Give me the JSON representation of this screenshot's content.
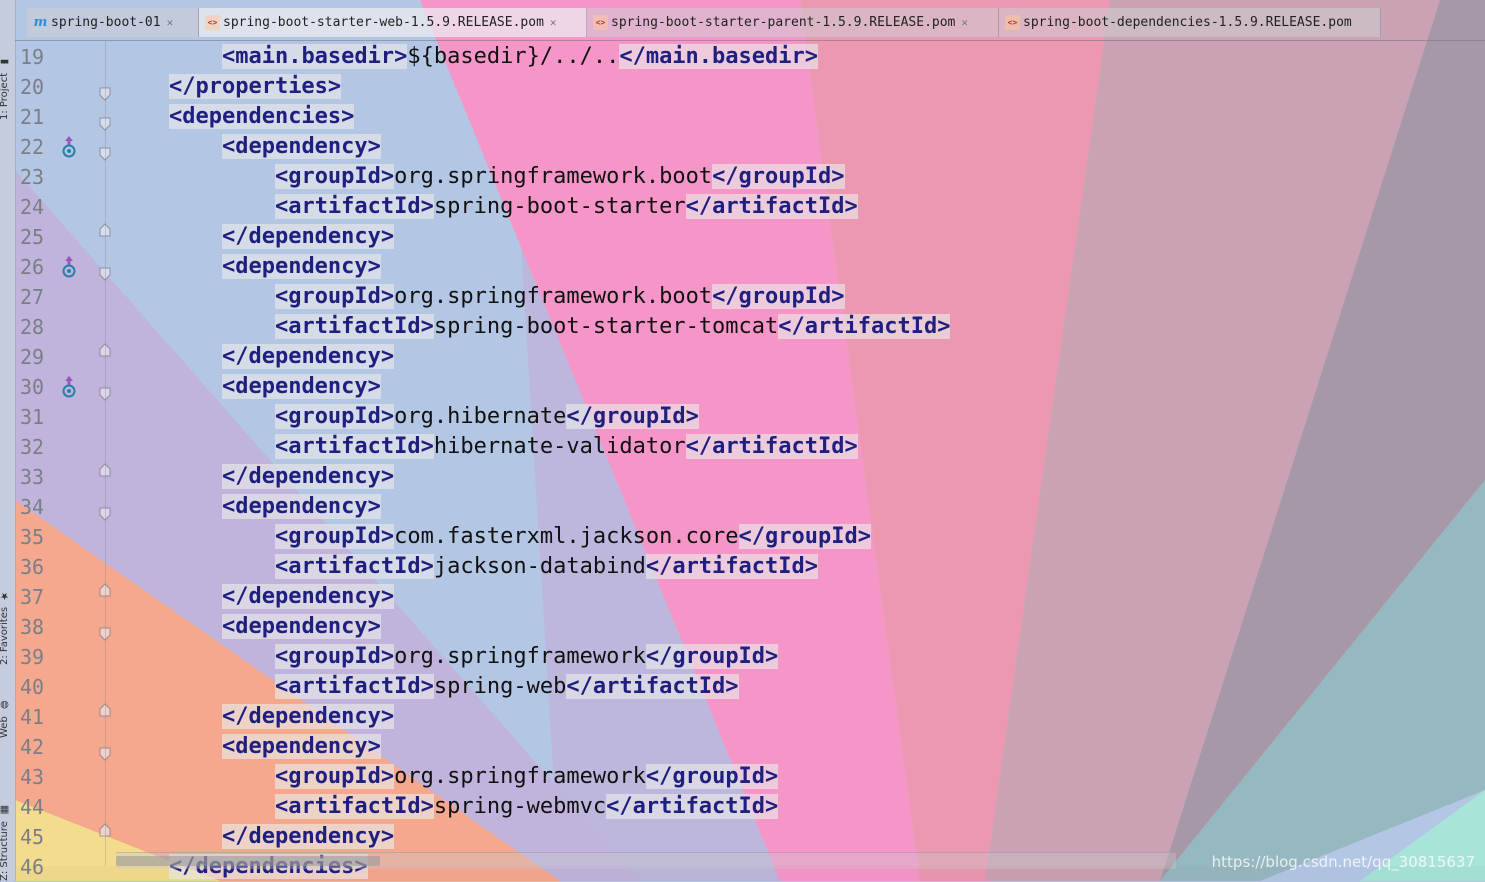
{
  "tabs": [
    {
      "label": "spring-boot-01",
      "icon": "maven-module-icon",
      "active": false
    },
    {
      "label": "spring-boot-starter-web-1.5.9.RELEASE.pom",
      "icon": "xml-file-icon",
      "active": true
    },
    {
      "label": "spring-boot-starter-parent-1.5.9.RELEASE.pom",
      "icon": "xml-file-icon",
      "active": false
    },
    {
      "label": "spring-boot-dependencies-1.5.9.RELEASE.pom",
      "icon": "xml-file-icon",
      "active": false
    }
  ],
  "tool_windows": [
    {
      "label": "1: Project",
      "icon": "folder-icon"
    },
    {
      "label": "2: Favorites",
      "icon": "star-icon"
    },
    {
      "label": "Web",
      "icon": "globe-icon"
    },
    {
      "label": "Z: Structure",
      "icon": "structure-icon"
    }
  ],
  "line_numbers": [
    "19",
    "20",
    "21",
    "22",
    "23",
    "24",
    "25",
    "26",
    "27",
    "28",
    "29",
    "30",
    "31",
    "32",
    "33",
    "34",
    "35",
    "36",
    "37",
    "38",
    "39",
    "40",
    "41",
    "42",
    "43",
    "44",
    "45",
    "46"
  ],
  "implemented_markers_lines": [
    "22",
    "26",
    "30"
  ],
  "code": [
    {
      "n": "19",
      "i": 2,
      "parts": [
        {
          "t": "<main.basedir>"
        },
        {
          "x": "${basedir}/../.."
        },
        {
          "t": "</main.basedir>"
        }
      ]
    },
    {
      "n": "20",
      "i": 1,
      "parts": [
        {
          "t": "</properties>"
        }
      ]
    },
    {
      "n": "21",
      "i": 1,
      "parts": [
        {
          "t": "<dependencies>"
        }
      ]
    },
    {
      "n": "22",
      "i": 2,
      "parts": [
        {
          "t": "<dependency>"
        }
      ]
    },
    {
      "n": "23",
      "i": 3,
      "parts": [
        {
          "t": "<groupId>"
        },
        {
          "x": "org.springframework.boot"
        },
        {
          "t": "</groupId>"
        }
      ]
    },
    {
      "n": "24",
      "i": 3,
      "parts": [
        {
          "t": "<artifactId>"
        },
        {
          "x": "spring-boot-starter"
        },
        {
          "t": "</artifactId>"
        }
      ]
    },
    {
      "n": "25",
      "i": 2,
      "parts": [
        {
          "t": "</dependency>"
        }
      ]
    },
    {
      "n": "26",
      "i": 2,
      "parts": [
        {
          "t": "<dependency>"
        }
      ]
    },
    {
      "n": "27",
      "i": 3,
      "parts": [
        {
          "t": "<groupId>"
        },
        {
          "x": "org.springframework.boot"
        },
        {
          "t": "</groupId>"
        }
      ]
    },
    {
      "n": "28",
      "i": 3,
      "parts": [
        {
          "t": "<artifactId>"
        },
        {
          "x": "spring-boot-starter-tomcat"
        },
        {
          "t": "</artifactId>"
        }
      ]
    },
    {
      "n": "29",
      "i": 2,
      "parts": [
        {
          "t": "</dependency>"
        }
      ]
    },
    {
      "n": "30",
      "i": 2,
      "parts": [
        {
          "t": "<dependency>"
        }
      ]
    },
    {
      "n": "31",
      "i": 3,
      "parts": [
        {
          "t": "<groupId>"
        },
        {
          "x": "org.hibernate"
        },
        {
          "t": "</groupId>"
        }
      ]
    },
    {
      "n": "32",
      "i": 3,
      "parts": [
        {
          "t": "<artifactId>"
        },
        {
          "x": "hibernate-validator"
        },
        {
          "t": "</artifactId>"
        }
      ]
    },
    {
      "n": "33",
      "i": 2,
      "parts": [
        {
          "t": "</dependency>"
        }
      ]
    },
    {
      "n": "34",
      "i": 2,
      "parts": [
        {
          "t": "<dependency>"
        }
      ]
    },
    {
      "n": "35",
      "i": 3,
      "parts": [
        {
          "t": "<groupId>"
        },
        {
          "x": "com.fasterxml.jackson.core"
        },
        {
          "t": "</groupId>"
        }
      ]
    },
    {
      "n": "36",
      "i": 3,
      "parts": [
        {
          "t": "<artifactId>"
        },
        {
          "x": "jackson-databind"
        },
        {
          "t": "</artifactId>"
        }
      ]
    },
    {
      "n": "37",
      "i": 2,
      "parts": [
        {
          "t": "</dependency>"
        }
      ]
    },
    {
      "n": "38",
      "i": 2,
      "parts": [
        {
          "t": "<dependency>"
        }
      ]
    },
    {
      "n": "39",
      "i": 3,
      "parts": [
        {
          "t": "<groupId>"
        },
        {
          "x": "org.springframework"
        },
        {
          "t": "</groupId>"
        }
      ]
    },
    {
      "n": "40",
      "i": 3,
      "parts": [
        {
          "t": "<artifactId>"
        },
        {
          "x": "spring-web"
        },
        {
          "t": "</artifactId>"
        }
      ]
    },
    {
      "n": "41",
      "i": 2,
      "parts": [
        {
          "t": "</dependency>"
        }
      ]
    },
    {
      "n": "42",
      "i": 2,
      "parts": [
        {
          "t": "<dependency>"
        }
      ]
    },
    {
      "n": "43",
      "i": 3,
      "parts": [
        {
          "t": "<groupId>"
        },
        {
          "x": "org.springframework"
        },
        {
          "t": "</groupId>"
        }
      ]
    },
    {
      "n": "44",
      "i": 3,
      "parts": [
        {
          "t": "<artifactId>"
        },
        {
          "x": "spring-webmvc"
        },
        {
          "t": "</artifactId>"
        }
      ]
    },
    {
      "n": "45",
      "i": 2,
      "parts": [
        {
          "t": "</dependency>"
        }
      ]
    },
    {
      "n": "46",
      "i": 1,
      "parts": [
        {
          "t": "</dependencies>"
        }
      ]
    }
  ],
  "watermark": "https://blog.csdn.net/qq_30815637",
  "colors": {
    "tag_text": "#1f1f80",
    "tag_bg": "#e8e8e8",
    "line_number": "#7a7f87",
    "implemented_marker": "#2a7fa8",
    "background_rays": [
      "#b3c6e4",
      "#c0b4dc",
      "#f5a88e",
      "#f3dc8e",
      "#f696c8",
      "#ec98b0",
      "#cba2b4",
      "#a698a6",
      "#96b8c0",
      "#a8e4d8"
    ]
  }
}
